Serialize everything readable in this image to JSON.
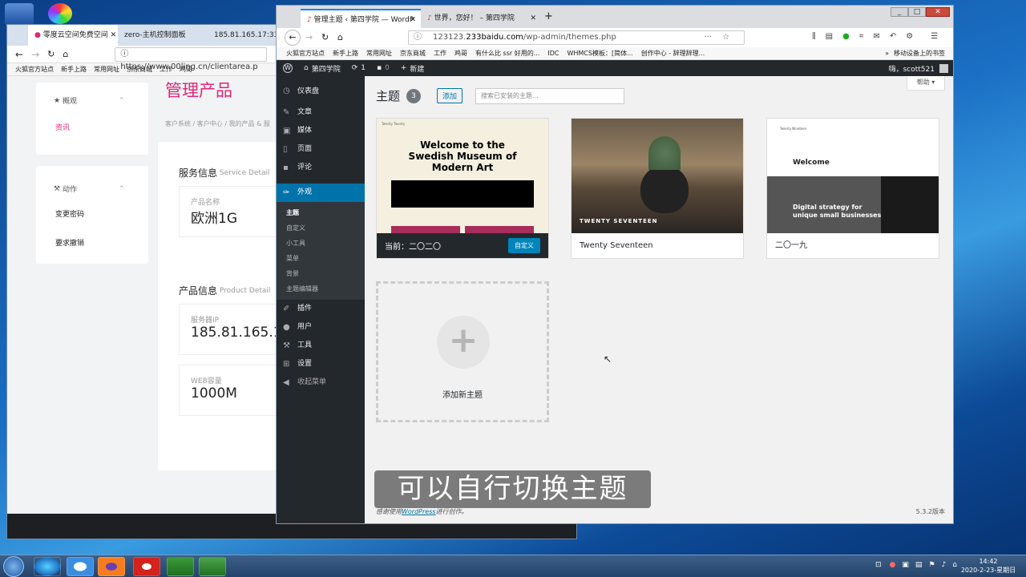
{
  "back_window": {
    "tabs": [
      "零度云空间免费空间",
      "zero-主机控制面板",
      "185.81.165.17:3312..."
    ],
    "url": "https://www.00ling.cn/clientarea.p",
    "bookmarks": [
      "火狐官方站点",
      "新手上路",
      "常用网址",
      "京东商城",
      "工作",
      "鸡哥"
    ],
    "page_title": "管理产品",
    "breadcrumb": [
      "客户系统",
      "客户中心",
      "我的产品 & 服"
    ],
    "overview_label": "概观",
    "info_label": "资讯",
    "actions_label": "动作",
    "action_items": [
      "变更密码",
      "要求撤销"
    ],
    "service_title": "服务信息",
    "service_title_en": "Service Detail",
    "product_name_label": "产品名称",
    "product_name_value": "欧洲1G",
    "product_title": "产品信息",
    "product_title_en": "Product Detail",
    "ip_label": "服务器IP",
    "ip_value": "185.81.165.1",
    "web_label": "WEB容量",
    "web_value": "1000M"
  },
  "front_window": {
    "tabs": [
      "管理主题 ‹ 第四学院 — WordP",
      "世界，您好！ – 第四学院"
    ],
    "url_prefix": "123123.",
    "url_domain": "233baidu.com",
    "url_path": "/wp-admin/themes.php",
    "bookmarks": [
      "火狐官方站点",
      "新手上路",
      "常用网址",
      "京东商城",
      "工作",
      "鸡哥",
      "有什么比 ssr 好用的...",
      "IDC",
      "WHMCS模板：[简体...",
      "创作中心 - 辞理辞理..."
    ],
    "mobile_bookmarks": "移动设备上的书签",
    "admin_bar": {
      "site": "第四学院",
      "updates": "1",
      "comments": "0",
      "new": "新建",
      "howdy": "嗨，scott521"
    },
    "help": "帮助",
    "menu": [
      "仪表盘",
      "文章",
      "媒体",
      "页面",
      "评论",
      "外观",
      "插件",
      "用户",
      "工具",
      "设置",
      "收起菜单"
    ],
    "appearance_submenu": [
      "主题",
      "自定义",
      "小工具",
      "菜单",
      "背景",
      "主题编辑器"
    ],
    "themes_heading": "主题",
    "themes_count": "3",
    "add_button": "添加",
    "search_placeholder": "搜索已安装的主题...",
    "themes": [
      {
        "name": "当前：二〇二〇",
        "customize": "自定义",
        "shot_title": "Welcome to the Swedish Museum of Modern Art"
      },
      {
        "name": "Twenty Seventeen",
        "shot_title": "TWENTY SEVENTEEN"
      },
      {
        "name": "二〇一九",
        "shot_title": "Welcome",
        "shot_sub": "Digital strategy for unique small businesses"
      }
    ],
    "add_new_theme": "添加新主题",
    "footer_left_prefix": "感谢使用",
    "footer_link": "WordPress",
    "footer_left_suffix": "进行创作。",
    "footer_version": "5.3.2版本"
  },
  "caption": "可以自行切换主题",
  "taskbar": {
    "time": "14:42",
    "date": "2020-2-23-星期日"
  }
}
